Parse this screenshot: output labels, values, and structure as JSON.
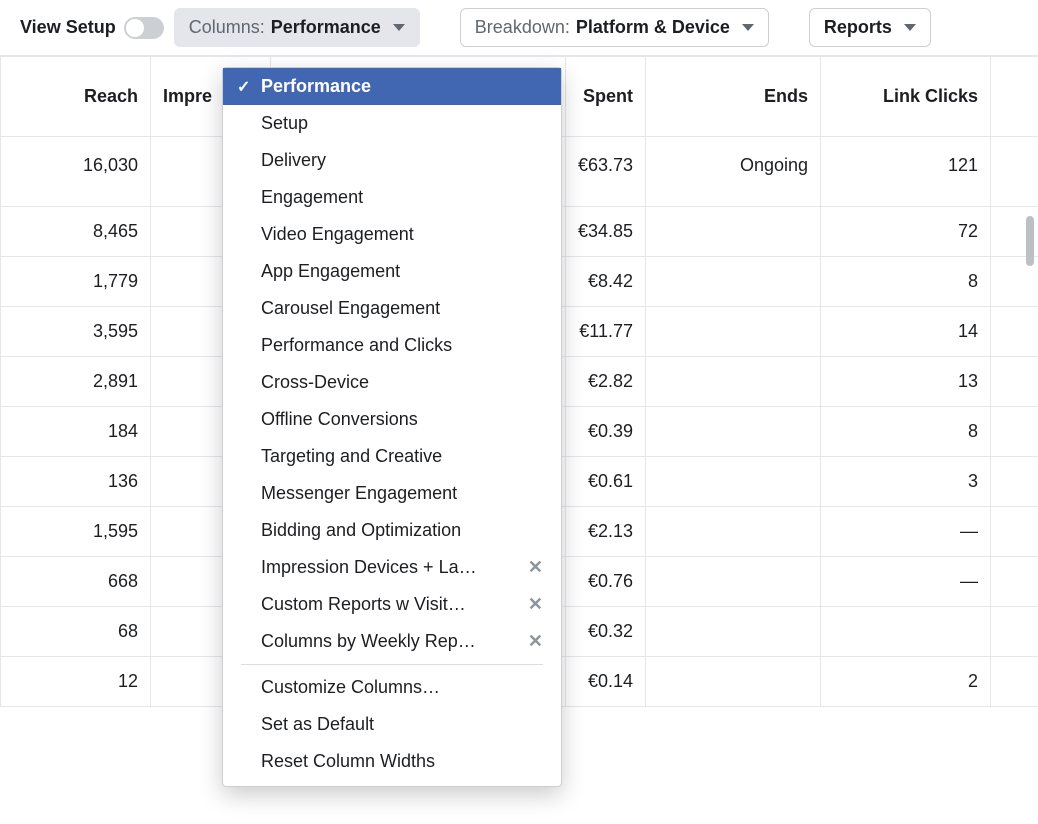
{
  "toolbar": {
    "view_setup_label": "View Setup",
    "columns_label": "Columns:",
    "columns_value": "Performance",
    "breakdown_label": "Breakdown:",
    "breakdown_value": "Platform & Device",
    "reports_label": "Reports"
  },
  "dropdown": {
    "items": [
      {
        "label": "Performance",
        "selected": true
      },
      {
        "label": "Setup"
      },
      {
        "label": "Delivery"
      },
      {
        "label": "Engagement"
      },
      {
        "label": "Video Engagement"
      },
      {
        "label": "App Engagement"
      },
      {
        "label": "Carousel Engagement"
      },
      {
        "label": "Performance and Clicks"
      },
      {
        "label": "Cross-Device"
      },
      {
        "label": "Offline Conversions"
      },
      {
        "label": "Targeting and Creative"
      },
      {
        "label": "Messenger Engagement"
      },
      {
        "label": "Bidding and Optimization"
      },
      {
        "label": "Impression Devices + La…",
        "removable": true
      },
      {
        "label": "Custom Reports w Visit…",
        "removable": true
      },
      {
        "label": "Columns by Weekly Rep…",
        "removable": true
      }
    ],
    "footer": [
      {
        "label": "Customize Columns…"
      },
      {
        "label": "Set as Default"
      },
      {
        "label": "Reset Column Widths"
      }
    ]
  },
  "table": {
    "headers": {
      "reach": "Reach",
      "impressions": "Impre",
      "spent": "Spent",
      "ends": "Ends",
      "link_clicks": "Link Clicks"
    },
    "rows": [
      {
        "reach": "16,030",
        "spent": "€63.73",
        "ends": "Ongoing",
        "link_clicks": "121"
      },
      {
        "reach": "8,465",
        "spent": "€34.85",
        "ends": "",
        "link_clicks": "72"
      },
      {
        "reach": "1,779",
        "spent": "€8.42",
        "ends": "",
        "link_clicks": "8"
      },
      {
        "reach": "3,595",
        "spent": "€11.77",
        "ends": "",
        "link_clicks": "14"
      },
      {
        "reach": "2,891",
        "spent": "€2.82",
        "ends": "",
        "link_clicks": "13"
      },
      {
        "reach": "184",
        "spent": "€0.39",
        "ends": "",
        "link_clicks": "8"
      },
      {
        "reach": "136",
        "spent": "€0.61",
        "ends": "",
        "link_clicks": "3"
      },
      {
        "reach": "1,595",
        "spent": "€2.13",
        "ends": "",
        "link_clicks": "—"
      },
      {
        "reach": "668",
        "spent": "€0.76",
        "ends": "",
        "link_clicks": "—"
      },
      {
        "reach": "68",
        "spent": "€0.32",
        "ends": "",
        "link_clicks": ""
      },
      {
        "reach": "12",
        "spent": "€0.14",
        "ends": "",
        "link_clicks": "2"
      }
    ]
  }
}
